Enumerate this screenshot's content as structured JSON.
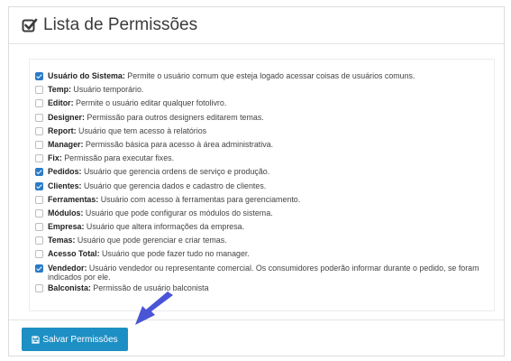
{
  "panel": {
    "title": "Lista de Permissões",
    "title_icon": "checkbox-checked-icon"
  },
  "permissions": [
    {
      "name": "Usuário do Sistema:",
      "desc": " Permite o usuário comum que esteja logado acessar coisas de usuários comuns.",
      "checked": true
    },
    {
      "name": "Temp:",
      "desc": " Usuário temporário.",
      "checked": false
    },
    {
      "name": "Editor:",
      "desc": " Permite o usuário editar qualquer fotolivro.",
      "checked": false
    },
    {
      "name": "Designer:",
      "desc": " Permissão para outros designers editarem temas.",
      "checked": false
    },
    {
      "name": "Report:",
      "desc": " Usuário que tem acesso à relatórios",
      "checked": false
    },
    {
      "name": "Manager:",
      "desc": " Permissão básica para acesso à área administrativa.",
      "checked": false
    },
    {
      "name": "Fix:",
      "desc": " Permissão para executar fixes.",
      "checked": false
    },
    {
      "name": "Pedidos:",
      "desc": " Usuário que gerencia ordens de serviço e produção.",
      "checked": true
    },
    {
      "name": "Clientes:",
      "desc": " Usuário que gerencia dados e cadastro de clientes.",
      "checked": true
    },
    {
      "name": "Ferramentas:",
      "desc": " Usuário com acesso à ferramentas para gerenciamento.",
      "checked": false
    },
    {
      "name": "Módulos:",
      "desc": " Usuário que pode configurar os módulos do sistema.",
      "checked": false
    },
    {
      "name": "Empresa:",
      "desc": " Usuário que altera informações da empresa.",
      "checked": false
    },
    {
      "name": "Temas:",
      "desc": " Usuário que pode gerenciar e criar temas.",
      "checked": false
    },
    {
      "name": "Acesso Total:",
      "desc": " Usuário que pode fazer tudo no manager.",
      "checked": false
    },
    {
      "name": "Vendedor:",
      "desc": " Usuário vendedor ou representante comercial. Os consumidores poderão informar durante o pedido, se foram indicados por ele.",
      "checked": true
    },
    {
      "name": "Balconista:",
      "desc": " Permissão de usuário balconista",
      "checked": false
    }
  ],
  "footer": {
    "save_label": "Salvar Permissões",
    "save_icon": "floppy-disk-icon"
  },
  "annotation": {
    "arrow_icon": "pointer-arrow-icon",
    "arrow_color": "#4a55d6"
  },
  "colors": {
    "accent": "#1d8fc4",
    "checkbox_checked": "#2a7ac7"
  }
}
